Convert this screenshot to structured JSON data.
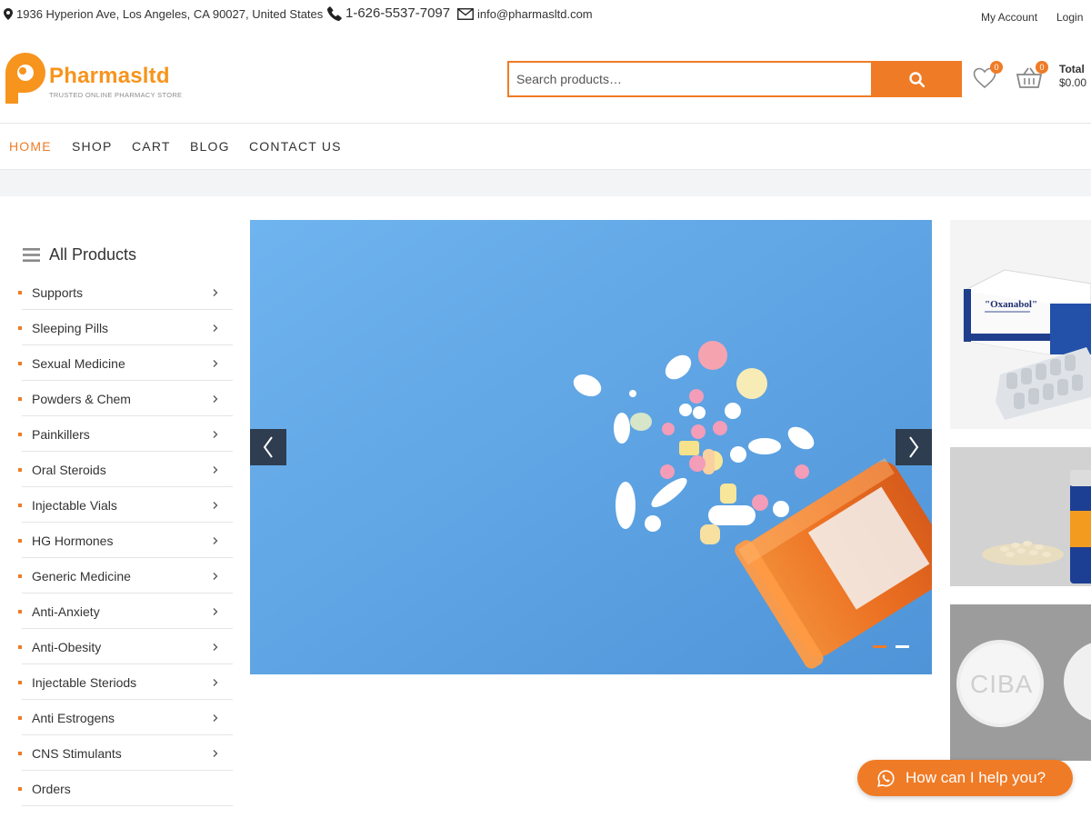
{
  "topbar": {
    "address": "1936 Hyperion Ave, Los Angeles, CA 90027, United States",
    "phone": "1-626-5537-7097",
    "email": "info@pharmasltd.com",
    "my_account": "My Account",
    "login": "Login"
  },
  "header": {
    "logo_text": "Pharmasltd",
    "logo_tagline": "TRUSTED ONLINE PHARMACY STORE",
    "search_placeholder": "Search products…",
    "wishlist_count": "0",
    "cart_count": "0",
    "total_label": "Total",
    "total_value": "$0.00"
  },
  "nav": {
    "items": [
      {
        "label": "HOME",
        "active": true
      },
      {
        "label": "SHOP"
      },
      {
        "label": "CART"
      },
      {
        "label": "BLOG"
      },
      {
        "label": "CONTACT US"
      }
    ]
  },
  "sidebar": {
    "title": "All Products",
    "items": [
      {
        "label": "Supports",
        "has_children": true
      },
      {
        "label": "Sleeping Pills",
        "has_children": true
      },
      {
        "label": "Sexual Medicine",
        "has_children": true
      },
      {
        "label": "Powders & Chem",
        "has_children": true
      },
      {
        "label": "Painkillers",
        "has_children": true
      },
      {
        "label": "Oral Steroids",
        "has_children": true
      },
      {
        "label": "Injectable Vials",
        "has_children": true
      },
      {
        "label": "HG Hormones",
        "has_children": true
      },
      {
        "label": "Generic Medicine",
        "has_children": true
      },
      {
        "label": "Anti-Anxiety",
        "has_children": true
      },
      {
        "label": "Anti-Obesity",
        "has_children": true
      },
      {
        "label": "Injectable Steriods",
        "has_children": true
      },
      {
        "label": "Anti Estrogens",
        "has_children": true
      },
      {
        "label": "CNS Stimulants",
        "has_children": true
      },
      {
        "label": "Orders",
        "has_children": false
      }
    ]
  },
  "slider": {
    "slide_count": 2,
    "active_slide": 1
  },
  "banners": {
    "banner_1_text_1": "\"Oxanabol\"",
    "banner_3_text": "CIBA"
  },
  "chat": {
    "label": "How can I help you?"
  },
  "colors": {
    "accent": "#f07b26",
    "slider_bg": "#62a6e8",
    "arrow_bg": "#2e3d4f"
  }
}
